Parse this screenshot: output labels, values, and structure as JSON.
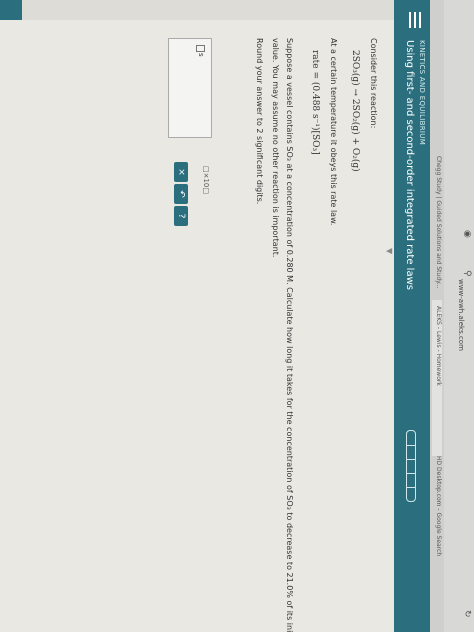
{
  "browser": {
    "url": "www-awh.aleks.com",
    "tabs": [
      "Chegg Study | Guided Solutions and Study...",
      "ALEKS - Lewis - Homework",
      "HD Desktop.com - Google Search"
    ]
  },
  "banner": {
    "topic": "KINETICS AND EQUILIBRIUM",
    "title": "Using first- and second-order integrated rate laws"
  },
  "question": {
    "intro": "Consider this reaction:",
    "reaction": "2SO₃(g) → 2SO₂(g) + O₂(g)",
    "rate_intro": "At a certain temperature it obeys this rate law.",
    "rate_law": "rate = (0.488 s⁻¹)[SO₃]",
    "body1": "Suppose a vessel contains SO₃ at a concentration of 0.280 M. Calculate how long it takes for the concentration of SO₃ to decrease to 21.0% of its initial",
    "body2": "value. You may assume no other reaction is important.",
    "body3": "Round your answer to 2 significant digits."
  },
  "answer": {
    "unit": "s",
    "sci_notation": "□×10□"
  },
  "tools": {
    "clear": "×",
    "undo": "↶",
    "help": "?"
  }
}
